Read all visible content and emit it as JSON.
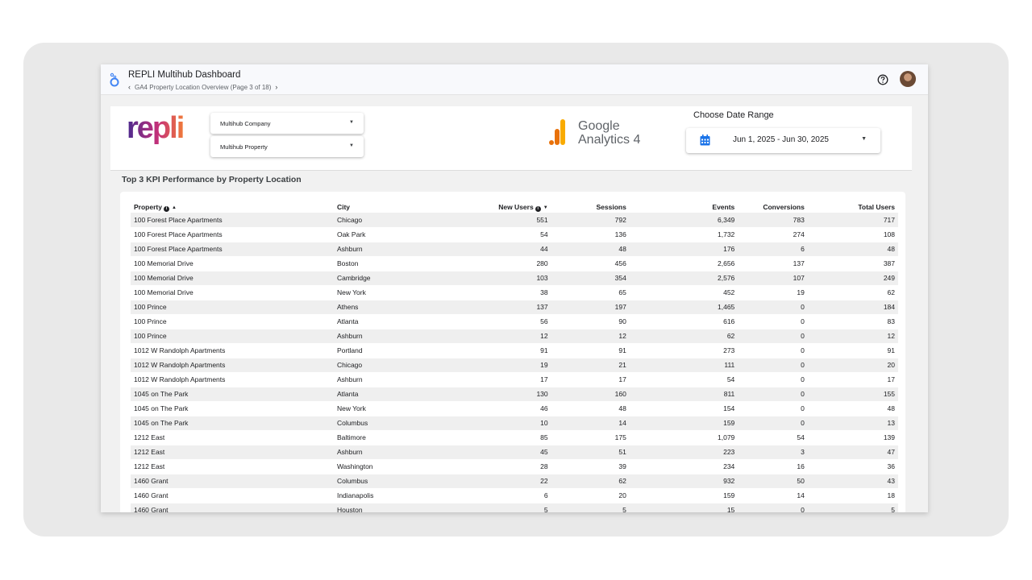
{
  "app": {
    "title": "REPLI Multihub Dashboard",
    "breadcrumb": "GA4 Property Location Overview (Page 3 of 18)",
    "prev_icon": "chevron-left-icon",
    "next_icon": "chevron-right-icon",
    "help_icon": "help-circle-icon"
  },
  "header": {
    "logo_text": "repli",
    "company_select": "Multihub Company",
    "property_select": "Multihub Property",
    "ga_line1": "Google",
    "ga_line2": "Analytics 4",
    "date_title": "Choose Date Range",
    "date_value": "Jun 1, 2025 - Jun 30, 2025"
  },
  "section": {
    "title": "Top 3 KPI Performance by Property Location"
  },
  "table": {
    "headers": {
      "property": "Property",
      "city": "City",
      "new_users": "New Users",
      "sessions": "Sessions",
      "events": "Events",
      "conversions": "Conversions",
      "total_users": "Total Users"
    },
    "rows": [
      [
        "100 Forest Place Apartments",
        "Chicago",
        "551",
        "792",
        "6,349",
        "783",
        "717"
      ],
      [
        "100 Forest Place Apartments",
        "Oak Park",
        "54",
        "136",
        "1,732",
        "274",
        "108"
      ],
      [
        "100 Forest Place Apartments",
        "Ashburn",
        "44",
        "48",
        "176",
        "6",
        "48"
      ],
      [
        "100 Memorial Drive",
        "Boston",
        "280",
        "456",
        "2,656",
        "137",
        "387"
      ],
      [
        "100 Memorial Drive",
        "Cambridge",
        "103",
        "354",
        "2,576",
        "107",
        "249"
      ],
      [
        "100 Memorial Drive",
        "New York",
        "38",
        "65",
        "452",
        "19",
        "62"
      ],
      [
        "100 Prince",
        "Athens",
        "137",
        "197",
        "1,465",
        "0",
        "184"
      ],
      [
        "100 Prince",
        "Atlanta",
        "56",
        "90",
        "616",
        "0",
        "83"
      ],
      [
        "100 Prince",
        "Ashburn",
        "12",
        "12",
        "62",
        "0",
        "12"
      ],
      [
        "1012 W Randolph Apartments",
        "Portland",
        "91",
        "91",
        "273",
        "0",
        "91"
      ],
      [
        "1012 W Randolph Apartments",
        "Chicago",
        "19",
        "21",
        "111",
        "0",
        "20"
      ],
      [
        "1012 W Randolph Apartments",
        "Ashburn",
        "17",
        "17",
        "54",
        "0",
        "17"
      ],
      [
        "1045 on The Park",
        "Atlanta",
        "130",
        "160",
        "811",
        "0",
        "155"
      ],
      [
        "1045 on The Park",
        "New York",
        "46",
        "48",
        "154",
        "0",
        "48"
      ],
      [
        "1045 on The Park",
        "Columbus",
        "10",
        "14",
        "159",
        "0",
        "13"
      ],
      [
        "1212 East",
        "Baltimore",
        "85",
        "175",
        "1,079",
        "54",
        "139"
      ],
      [
        "1212 East",
        "Ashburn",
        "45",
        "51",
        "223",
        "3",
        "47"
      ],
      [
        "1212 East",
        "Washington",
        "28",
        "39",
        "234",
        "16",
        "36"
      ],
      [
        "1460 Grant",
        "Columbus",
        "22",
        "62",
        "932",
        "50",
        "43"
      ],
      [
        "1460 Grant",
        "Indianapolis",
        "6",
        "20",
        "159",
        "14",
        "18"
      ],
      [
        "1460 Grant",
        "Houston",
        "5",
        "5",
        "15",
        "0",
        "5"
      ]
    ]
  }
}
